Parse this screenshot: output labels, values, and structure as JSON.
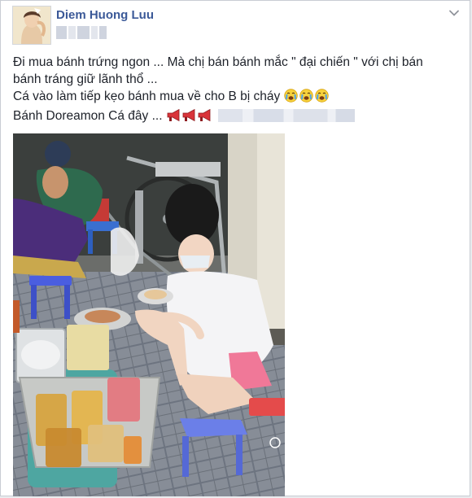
{
  "post": {
    "author_name": "Diem Huong Luu",
    "lines": [
      "Đi mua bánh trứng ngon ... Mà chị bán bánh mắc \" đại chiến \" với chị bán",
      "bánh tráng giữ lãnh thổ ...",
      "Cá vào làm tiếp kẹo bánh mua về cho B bị cháy",
      "Bánh Doreamon Cá đây ..."
    ],
    "emoji_crying_count": 3,
    "emoji_megaphone_count": 3
  },
  "icons": {
    "options": "chevron-down-icon",
    "crying": "crying-face-emoji",
    "megaphone": "megaphone-emoji"
  },
  "colors": {
    "author_name": "#3b5998",
    "text": "#1d2129",
    "card_border": "#c8ccd3"
  }
}
